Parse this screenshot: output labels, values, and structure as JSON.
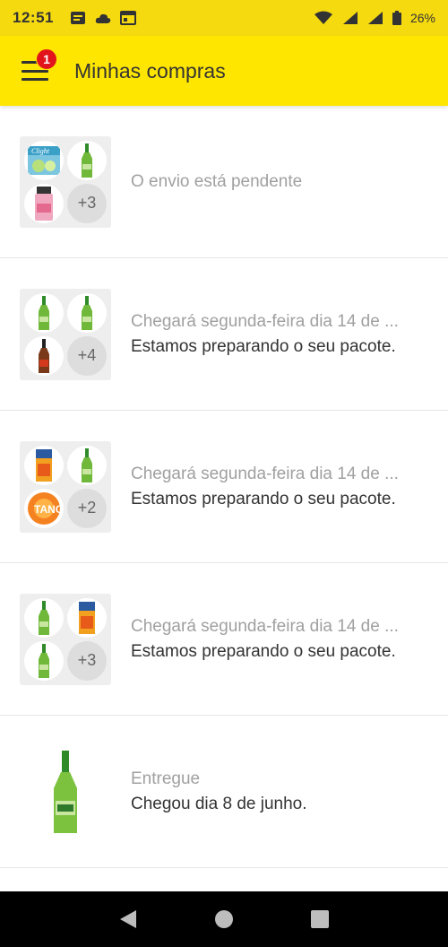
{
  "status_bar": {
    "time": "12:51",
    "battery": "26%",
    "icons": [
      "message-icon",
      "cloud-icon",
      "calendar-icon",
      "wifi-icon",
      "signal-icon",
      "battery-icon"
    ]
  },
  "app_bar": {
    "title": "Minhas compras",
    "badge_count": "1",
    "colors": {
      "bar": "#ffe600",
      "badge": "#e3151c"
    }
  },
  "purchases": [
    {
      "status": "O envio está pendente",
      "detail": "",
      "more_count": "+3",
      "thumbs": [
        "clight-juice",
        "beer-bottle",
        "jar-product"
      ]
    },
    {
      "status": "Chegará segunda-feira dia 14 de ...",
      "detail": "Estamos preparando o seu pacote.",
      "more_count": "+4",
      "thumbs": [
        "beer-bottle",
        "beer-bottle",
        "red-bottle"
      ]
    },
    {
      "status": "Chegará segunda-feira dia 14 de ...",
      "detail": "Estamos preparando o seu pacote.",
      "more_count": "+2",
      "thumbs": [
        "juice-box",
        "beer-bottle",
        "tang-packet"
      ]
    },
    {
      "status": "Chegará segunda-feira dia 14 de ...",
      "detail": "Estamos preparando o seu pacote.",
      "more_count": "+3",
      "thumbs": [
        "beer-bottle",
        "juice-box",
        "beer-bottle"
      ]
    },
    {
      "status": "Entregue",
      "detail": "Chegou dia 8 de junho.",
      "more_count": "",
      "thumbs": [
        "beer-bottle"
      ]
    }
  ],
  "nav_bar": {
    "buttons": [
      "back-icon",
      "home-icon",
      "recents-icon"
    ]
  }
}
